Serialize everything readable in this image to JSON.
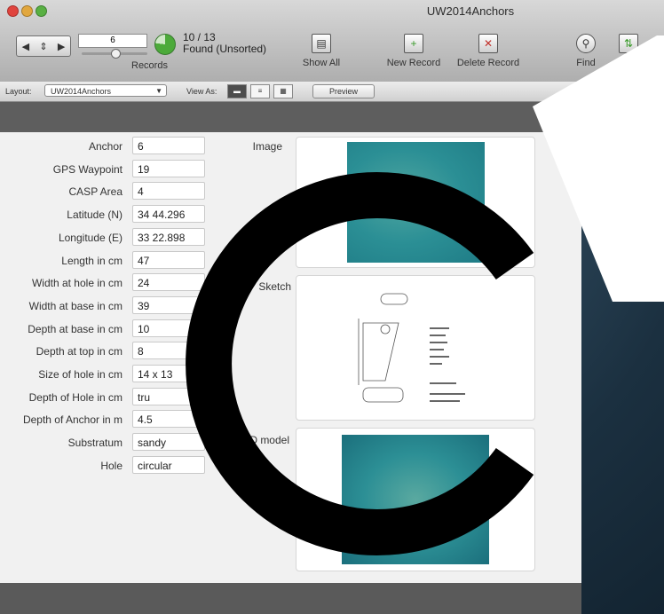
{
  "window": {
    "title": "UW2014Anchors"
  },
  "toolbar": {
    "current_record": "6",
    "records_label": "Records",
    "count": "10 / 13",
    "found_status": "Found (Unsorted)",
    "show_all": "Show All",
    "new_record": "New Record",
    "delete_record": "Delete Record",
    "find": "Find",
    "sort": "Sort",
    "found_fraction": 0.77
  },
  "layoutbar": {
    "layout_label": "Layout:",
    "layout_value": "UW2014Anchors",
    "view_as_label": "View As:",
    "preview": "Preview"
  },
  "fields": [
    {
      "label": "Anchor",
      "value": "6"
    },
    {
      "label": "GPS Waypoint",
      "value": "19"
    },
    {
      "label": "CASP Area",
      "value": "4"
    },
    {
      "label": "Latitude (N)",
      "value": "34 44.296"
    },
    {
      "label": "Longitude (E)",
      "value": "33 22.898"
    },
    {
      "label": "Length in cm",
      "value": "47"
    },
    {
      "label": "Width at hole in cm",
      "value": "24"
    },
    {
      "label": "Width at base in cm",
      "value": "39"
    },
    {
      "label": "Depth at base in cm",
      "value": "10"
    },
    {
      "label": "Depth at top in cm",
      "value": "8"
    },
    {
      "label": "Size of hole in cm",
      "value": "14 x 13"
    },
    {
      "label": "Depth of Hole in cm",
      "value": "tru"
    },
    {
      "label": "Depth of Anchor in m",
      "value": "4.5"
    },
    {
      "label": "Substratum",
      "value": "sandy"
    },
    {
      "label": "Hole",
      "value": "circular"
    }
  ],
  "media": {
    "image_label": "Image",
    "sketch_label": "Sketch",
    "model_label": "3D model"
  },
  "colors": {
    "underwater": "#2f9a9c",
    "header_strip": "#5e5e5e",
    "watermark": "#000000"
  }
}
